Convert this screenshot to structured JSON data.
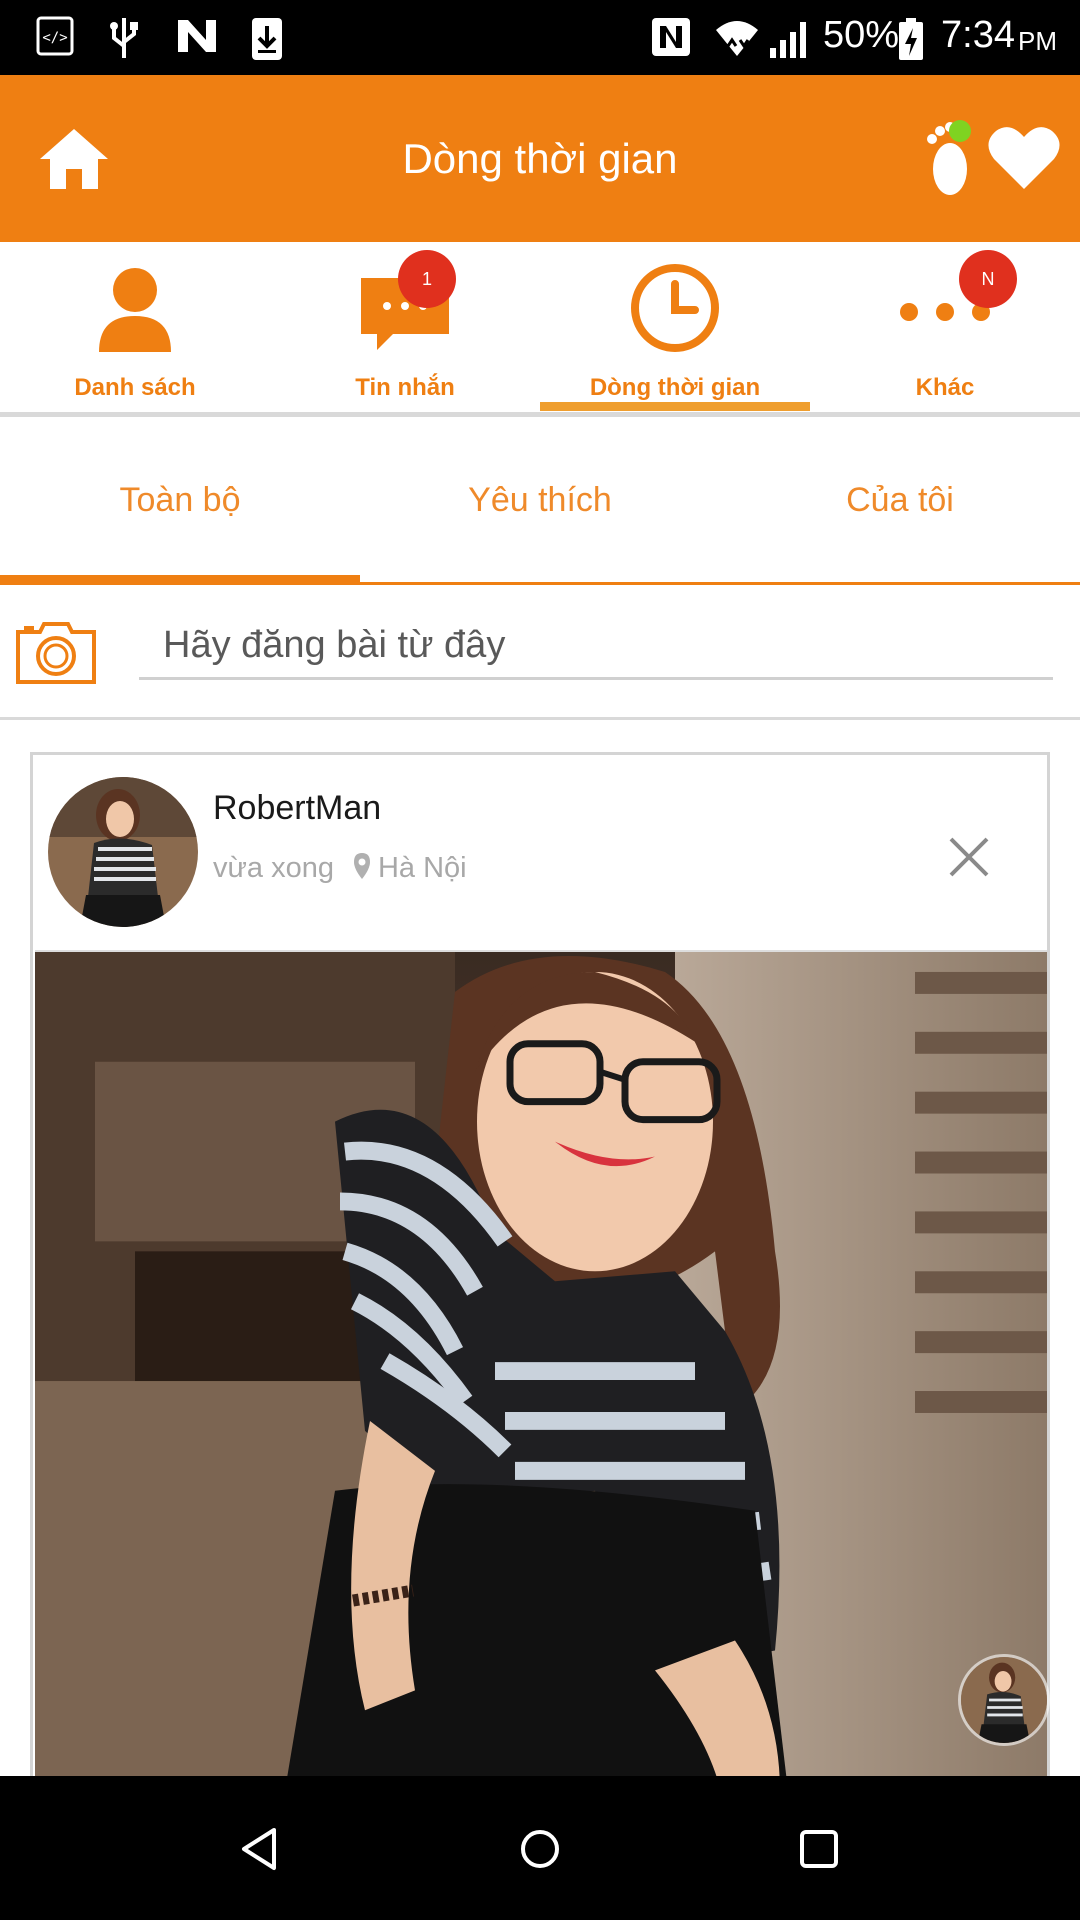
{
  "status_bar": {
    "battery": "50%",
    "time": "7:34",
    "ampm": "PM"
  },
  "toolbar": {
    "title": "Dòng thời gian",
    "icons": [
      "home-icon",
      "footprint-icon",
      "heart-icon"
    ]
  },
  "main_nav": [
    {
      "label": "Danh sách",
      "icon": "person-icon"
    },
    {
      "label": "Tin nhắn",
      "icon": "chat-icon",
      "badge": "1"
    },
    {
      "label": "Dòng thời gian",
      "icon": "clock-icon",
      "active": true
    },
    {
      "label": "Khác",
      "icon": "more-icon",
      "badge": "N"
    }
  ],
  "sub_tabs": [
    {
      "label": "Toàn bộ",
      "active": true
    },
    {
      "label": "Yêu thích"
    },
    {
      "label": "Của tôi"
    }
  ],
  "composer": {
    "placeholder": "Hãy đăng bài từ đây"
  },
  "post": {
    "username": "RobertMan",
    "time": "vừa xong",
    "location": "Hà Nội"
  },
  "colors": {
    "accent": "#ef7f12",
    "badge": "#e0301e",
    "divider": "#d9d9d9"
  }
}
